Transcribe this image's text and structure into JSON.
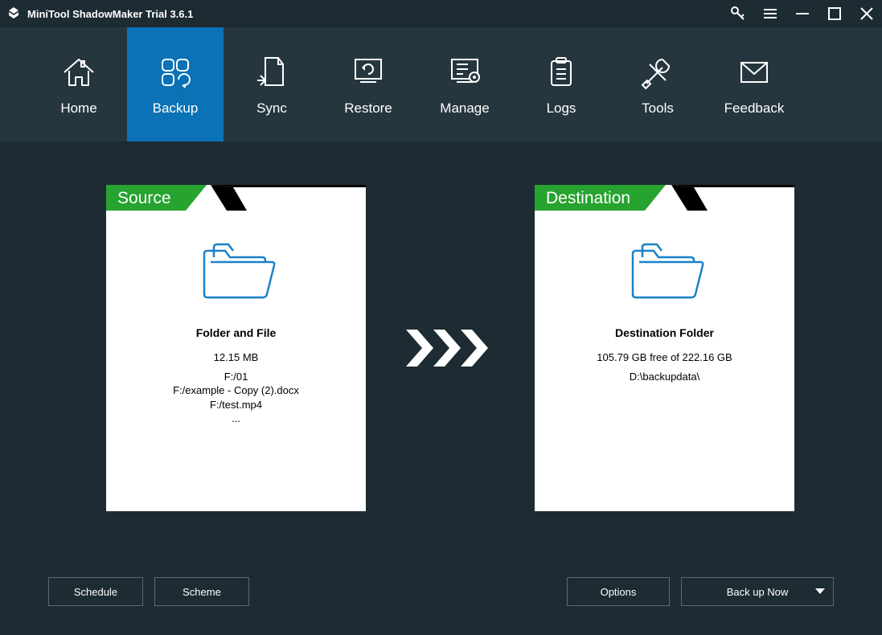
{
  "app": {
    "title": "MiniTool ShadowMaker Trial 3.6.1"
  },
  "tabs": [
    {
      "id": "home",
      "label": "Home",
      "active": false
    },
    {
      "id": "backup",
      "label": "Backup",
      "active": true
    },
    {
      "id": "sync",
      "label": "Sync",
      "active": false
    },
    {
      "id": "restore",
      "label": "Restore",
      "active": false
    },
    {
      "id": "manage",
      "label": "Manage",
      "active": false
    },
    {
      "id": "logs",
      "label": "Logs",
      "active": false
    },
    {
      "id": "tools",
      "label": "Tools",
      "active": false
    },
    {
      "id": "feedback",
      "label": "Feedback",
      "active": false
    }
  ],
  "source": {
    "header": "Source",
    "title": "Folder and File",
    "size": "12.15 MB",
    "items": [
      "F:/01",
      "F:/example - Copy (2).docx",
      "F:/test.mp4",
      "..."
    ]
  },
  "destination": {
    "header": "Destination",
    "title": "Destination Folder",
    "free_space": "105.79 GB free of 222.16 GB",
    "path": "D:\\backupdata\\"
  },
  "buttons": {
    "schedule": "Schedule",
    "scheme": "Scheme",
    "options": "Options",
    "backup_now": "Back up Now"
  },
  "colors": {
    "accent": "#0b72b5",
    "green": "#27a32f",
    "bg": "#1d2b33",
    "toolbar": "#26363f"
  }
}
